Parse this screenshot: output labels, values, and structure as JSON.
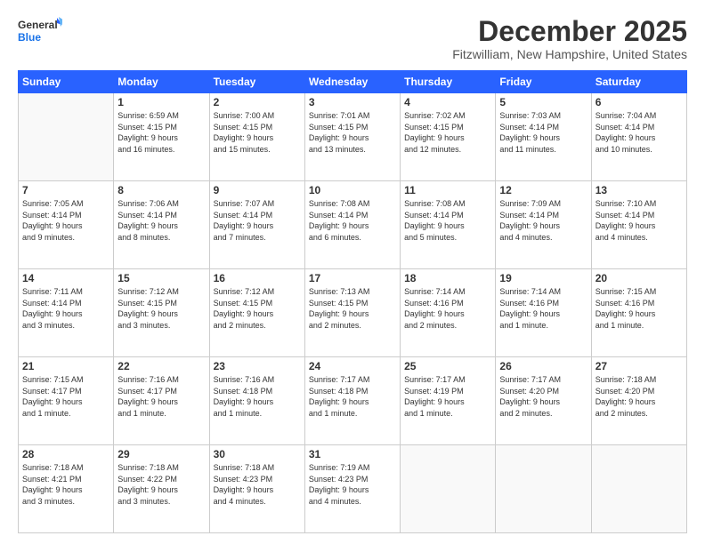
{
  "logo": {
    "line1": "General",
    "line2": "Blue"
  },
  "header": {
    "month": "December 2025",
    "location": "Fitzwilliam, New Hampshire, United States"
  },
  "weekdays": [
    "Sunday",
    "Monday",
    "Tuesday",
    "Wednesday",
    "Thursday",
    "Friday",
    "Saturday"
  ],
  "weeks": [
    [
      {
        "day": "",
        "info": ""
      },
      {
        "day": "1",
        "info": "Sunrise: 6:59 AM\nSunset: 4:15 PM\nDaylight: 9 hours\nand 16 minutes."
      },
      {
        "day": "2",
        "info": "Sunrise: 7:00 AM\nSunset: 4:15 PM\nDaylight: 9 hours\nand 15 minutes."
      },
      {
        "day": "3",
        "info": "Sunrise: 7:01 AM\nSunset: 4:15 PM\nDaylight: 9 hours\nand 13 minutes."
      },
      {
        "day": "4",
        "info": "Sunrise: 7:02 AM\nSunset: 4:15 PM\nDaylight: 9 hours\nand 12 minutes."
      },
      {
        "day": "5",
        "info": "Sunrise: 7:03 AM\nSunset: 4:14 PM\nDaylight: 9 hours\nand 11 minutes."
      },
      {
        "day": "6",
        "info": "Sunrise: 7:04 AM\nSunset: 4:14 PM\nDaylight: 9 hours\nand 10 minutes."
      }
    ],
    [
      {
        "day": "7",
        "info": "Sunrise: 7:05 AM\nSunset: 4:14 PM\nDaylight: 9 hours\nand 9 minutes."
      },
      {
        "day": "8",
        "info": "Sunrise: 7:06 AM\nSunset: 4:14 PM\nDaylight: 9 hours\nand 8 minutes."
      },
      {
        "day": "9",
        "info": "Sunrise: 7:07 AM\nSunset: 4:14 PM\nDaylight: 9 hours\nand 7 minutes."
      },
      {
        "day": "10",
        "info": "Sunrise: 7:08 AM\nSunset: 4:14 PM\nDaylight: 9 hours\nand 6 minutes."
      },
      {
        "day": "11",
        "info": "Sunrise: 7:08 AM\nSunset: 4:14 PM\nDaylight: 9 hours\nand 5 minutes."
      },
      {
        "day": "12",
        "info": "Sunrise: 7:09 AM\nSunset: 4:14 PM\nDaylight: 9 hours\nand 4 minutes."
      },
      {
        "day": "13",
        "info": "Sunrise: 7:10 AM\nSunset: 4:14 PM\nDaylight: 9 hours\nand 4 minutes."
      }
    ],
    [
      {
        "day": "14",
        "info": "Sunrise: 7:11 AM\nSunset: 4:14 PM\nDaylight: 9 hours\nand 3 minutes."
      },
      {
        "day": "15",
        "info": "Sunrise: 7:12 AM\nSunset: 4:15 PM\nDaylight: 9 hours\nand 3 minutes."
      },
      {
        "day": "16",
        "info": "Sunrise: 7:12 AM\nSunset: 4:15 PM\nDaylight: 9 hours\nand 2 minutes."
      },
      {
        "day": "17",
        "info": "Sunrise: 7:13 AM\nSunset: 4:15 PM\nDaylight: 9 hours\nand 2 minutes."
      },
      {
        "day": "18",
        "info": "Sunrise: 7:14 AM\nSunset: 4:16 PM\nDaylight: 9 hours\nand 2 minutes."
      },
      {
        "day": "19",
        "info": "Sunrise: 7:14 AM\nSunset: 4:16 PM\nDaylight: 9 hours\nand 1 minute."
      },
      {
        "day": "20",
        "info": "Sunrise: 7:15 AM\nSunset: 4:16 PM\nDaylight: 9 hours\nand 1 minute."
      }
    ],
    [
      {
        "day": "21",
        "info": "Sunrise: 7:15 AM\nSunset: 4:17 PM\nDaylight: 9 hours\nand 1 minute."
      },
      {
        "day": "22",
        "info": "Sunrise: 7:16 AM\nSunset: 4:17 PM\nDaylight: 9 hours\nand 1 minute."
      },
      {
        "day": "23",
        "info": "Sunrise: 7:16 AM\nSunset: 4:18 PM\nDaylight: 9 hours\nand 1 minute."
      },
      {
        "day": "24",
        "info": "Sunrise: 7:17 AM\nSunset: 4:18 PM\nDaylight: 9 hours\nand 1 minute."
      },
      {
        "day": "25",
        "info": "Sunrise: 7:17 AM\nSunset: 4:19 PM\nDaylight: 9 hours\nand 1 minute."
      },
      {
        "day": "26",
        "info": "Sunrise: 7:17 AM\nSunset: 4:20 PM\nDaylight: 9 hours\nand 2 minutes."
      },
      {
        "day": "27",
        "info": "Sunrise: 7:18 AM\nSunset: 4:20 PM\nDaylight: 9 hours\nand 2 minutes."
      }
    ],
    [
      {
        "day": "28",
        "info": "Sunrise: 7:18 AM\nSunset: 4:21 PM\nDaylight: 9 hours\nand 3 minutes."
      },
      {
        "day": "29",
        "info": "Sunrise: 7:18 AM\nSunset: 4:22 PM\nDaylight: 9 hours\nand 3 minutes."
      },
      {
        "day": "30",
        "info": "Sunrise: 7:18 AM\nSunset: 4:23 PM\nDaylight: 9 hours\nand 4 minutes."
      },
      {
        "day": "31",
        "info": "Sunrise: 7:19 AM\nSunset: 4:23 PM\nDaylight: 9 hours\nand 4 minutes."
      },
      {
        "day": "",
        "info": ""
      },
      {
        "day": "",
        "info": ""
      },
      {
        "day": "",
        "info": ""
      }
    ]
  ]
}
